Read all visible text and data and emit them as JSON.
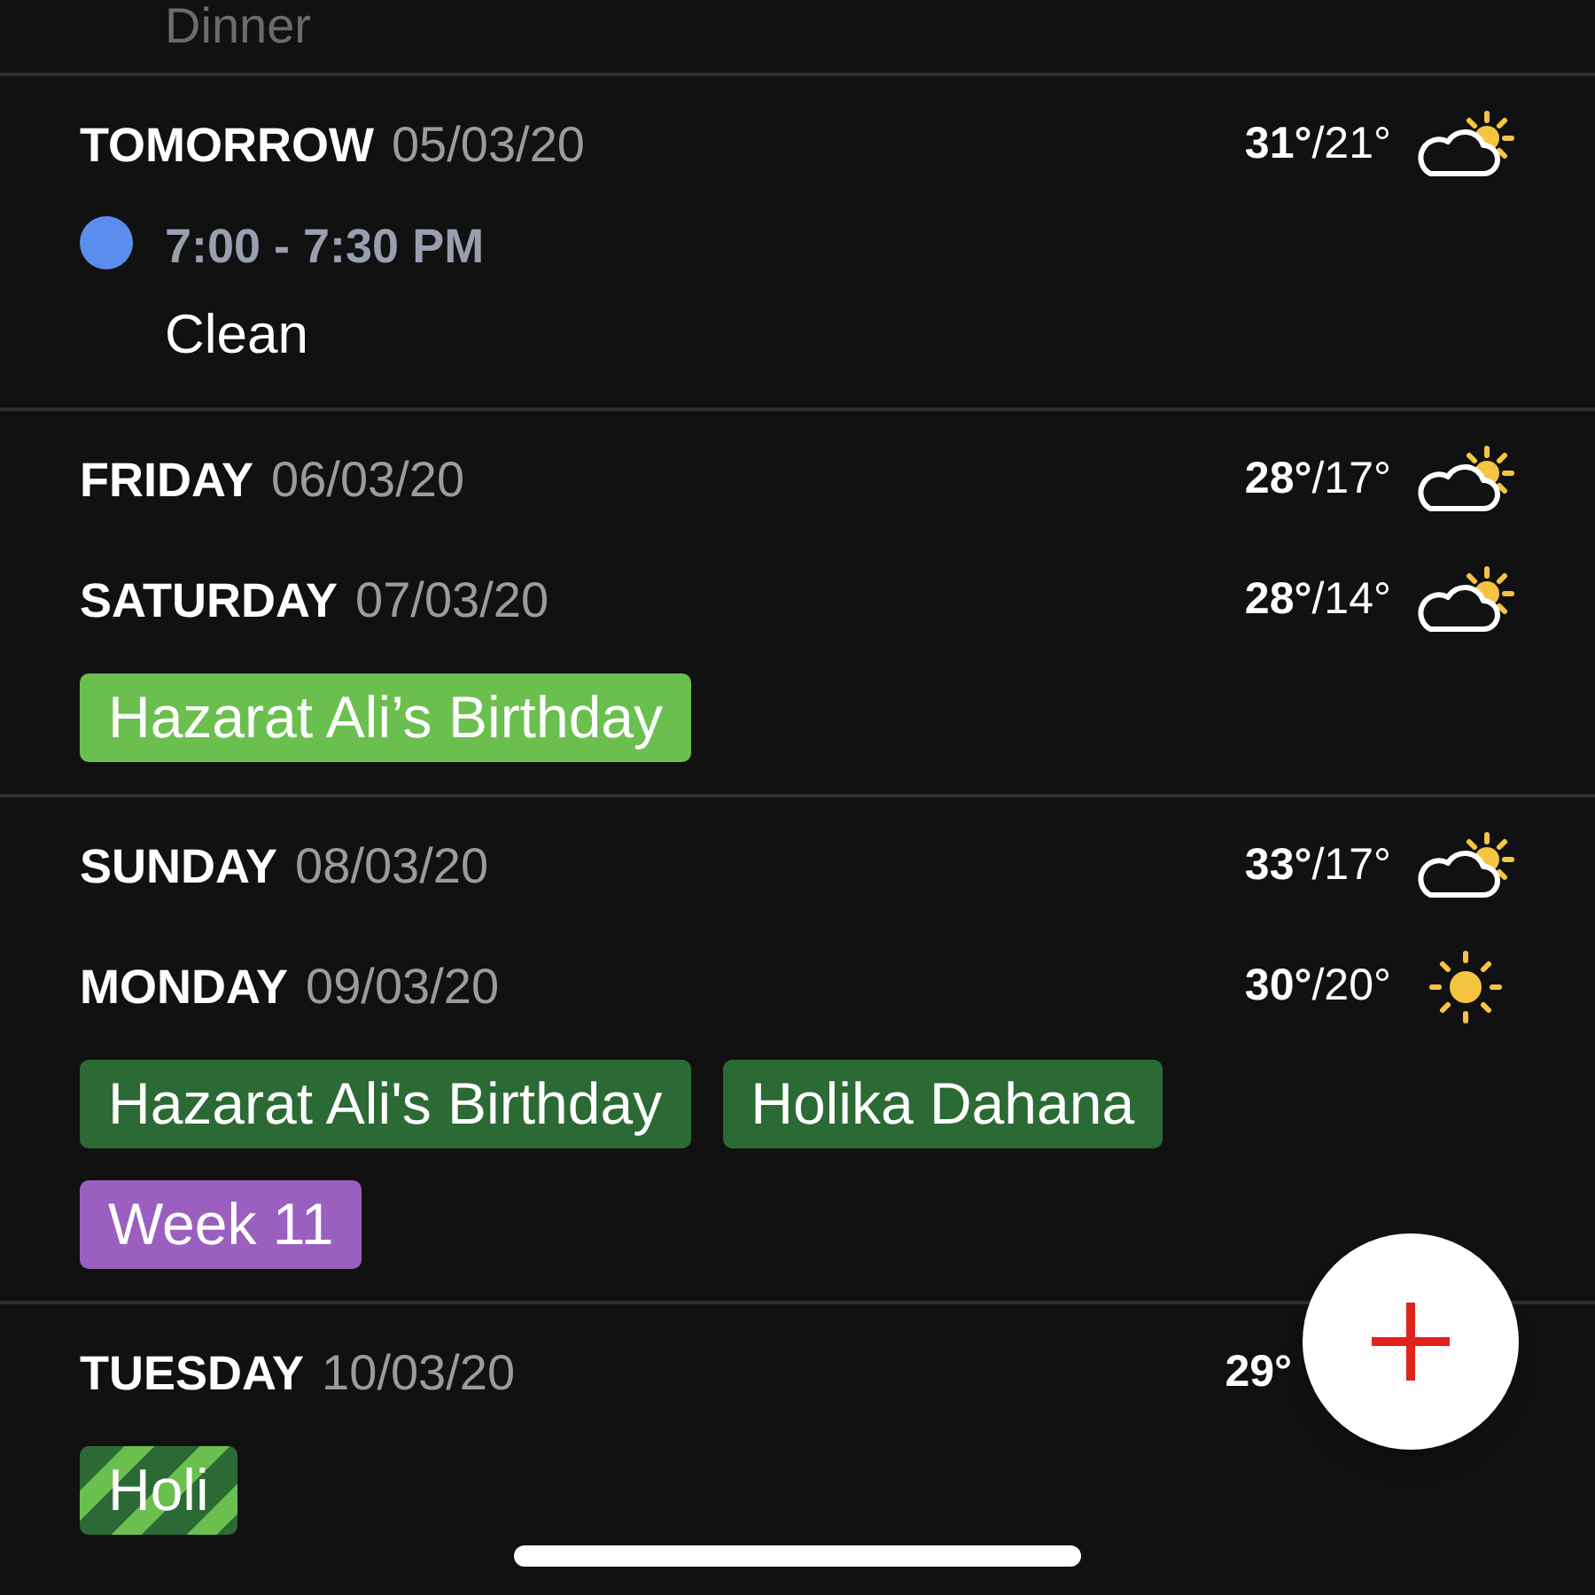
{
  "previous_event": {
    "title": "Dinner"
  },
  "sections": [
    {
      "days": [
        {
          "day": "TOMORROW",
          "date": "05/03/20",
          "high": "31°",
          "low": "/21°",
          "kind": "partly_cloudy"
        }
      ],
      "events": [
        {
          "time": "7:00 - 7:30 PM",
          "title": "Clean",
          "color": "#5b8def"
        }
      ]
    },
    {
      "days": [
        {
          "day": "FRIDAY",
          "date": "06/03/20",
          "high": "28°",
          "low": "/17°",
          "kind": "partly_cloudy"
        },
        {
          "day": "SATURDAY",
          "date": "07/03/20",
          "high": "28°",
          "low": "/14°",
          "kind": "partly_cloudy"
        }
      ],
      "tags": [
        {
          "label": "Hazarat Ali’s Birthday",
          "color": "#6bbf4e",
          "kind": "solid"
        }
      ]
    },
    {
      "days": [
        {
          "day": "SUNDAY",
          "date": "08/03/20",
          "high": "33°",
          "low": "/17°",
          "kind": "partly_cloudy"
        },
        {
          "day": "MONDAY",
          "date": "09/03/20",
          "high": "30°",
          "low": "/20°",
          "kind": "sunny"
        }
      ],
      "tags": [
        {
          "label": "Hazarat Ali's Birthday",
          "color": "#2b6a35",
          "kind": "solid"
        },
        {
          "label": "Holika Dahana",
          "color": "#2b6a35",
          "kind": "solid"
        },
        {
          "label": "Week 11",
          "color": "#9b5fc0",
          "kind": "solid"
        }
      ]
    },
    {
      "days": [
        {
          "day": "TUESDAY",
          "date": "10/03/20",
          "high": "29°"
        }
      ],
      "tags": [
        {
          "label": "Holi",
          "color": "#2b6a35",
          "kind": "striped"
        }
      ]
    }
  ]
}
